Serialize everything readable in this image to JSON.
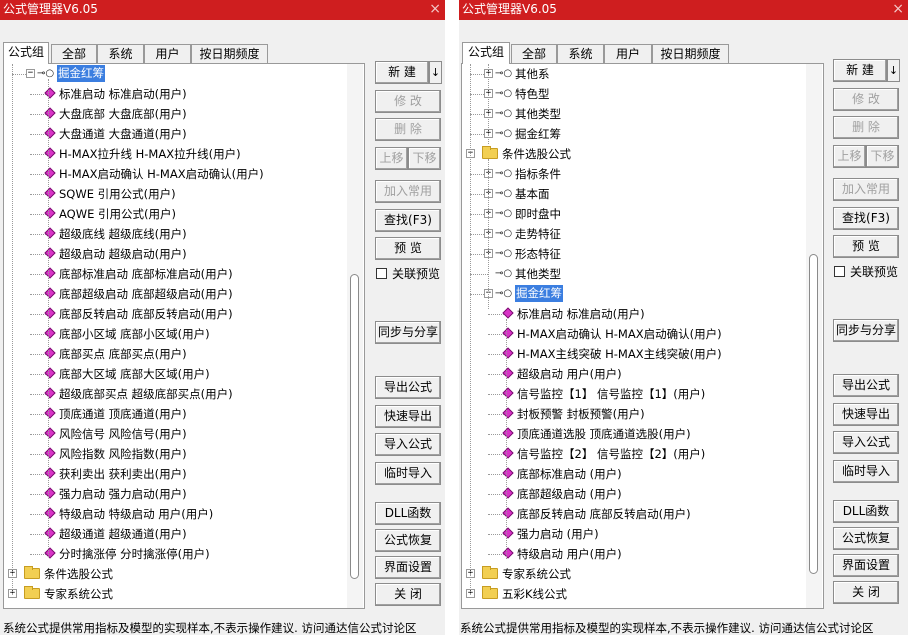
{
  "windows": [
    {
      "title": "公式管理器V6.05",
      "close_glyph": "×",
      "tabs": [
        "公式组",
        "全部",
        "系统",
        "用户",
        "按日期频度"
      ],
      "active_tab": 0,
      "tree": [
        {
          "depth": 1,
          "kind": "group",
          "expander": "minus",
          "text": "掘金红筹",
          "selected": true
        },
        {
          "depth": 2,
          "kind": "formula",
          "text": "标准启动   标准启动(用户)"
        },
        {
          "depth": 2,
          "kind": "formula",
          "text": "大盘底部   大盘底部(用户)"
        },
        {
          "depth": 2,
          "kind": "formula",
          "text": "大盘通道   大盘通道(用户)"
        },
        {
          "depth": 2,
          "kind": "formula",
          "text": "H-MAX拉升线   H-MAX拉升线(用户)"
        },
        {
          "depth": 2,
          "kind": "formula",
          "text": "H-MAX启动确认   H-MAX启动确认(用户)"
        },
        {
          "depth": 2,
          "kind": "formula",
          "text": "SQWE   引用公式(用户)"
        },
        {
          "depth": 2,
          "kind": "formula",
          "text": "AQWE   引用公式(用户)"
        },
        {
          "depth": 2,
          "kind": "formula",
          "text": "超级底线   超级底线(用户)"
        },
        {
          "depth": 2,
          "kind": "formula",
          "text": "超级启动   超级启动(用户)"
        },
        {
          "depth": 2,
          "kind": "formula",
          "text": "底部标准启动   底部标准启动(用户)"
        },
        {
          "depth": 2,
          "kind": "formula",
          "text": "底部超级启动   底部超级启动(用户)"
        },
        {
          "depth": 2,
          "kind": "formula",
          "text": "底部反转启动   底部反转启动(用户)"
        },
        {
          "depth": 2,
          "kind": "formula",
          "text": "底部小区域   底部小区域(用户)"
        },
        {
          "depth": 2,
          "kind": "formula",
          "text": "底部买点   底部买点(用户)"
        },
        {
          "depth": 2,
          "kind": "formula",
          "text": "底部大区域   底部大区域(用户)"
        },
        {
          "depth": 2,
          "kind": "formula",
          "text": "超级底部买点   超级底部买点(用户)"
        },
        {
          "depth": 2,
          "kind": "formula",
          "text": "顶底通道   顶底通道(用户)"
        },
        {
          "depth": 2,
          "kind": "formula",
          "text": "风险信号   风险信号(用户)"
        },
        {
          "depth": 2,
          "kind": "formula",
          "text": "风险指数   风险指数(用户)"
        },
        {
          "depth": 2,
          "kind": "formula",
          "text": "获利卖出   获利卖出(用户)"
        },
        {
          "depth": 2,
          "kind": "formula",
          "text": "强力启动   强力启动(用户)"
        },
        {
          "depth": 2,
          "kind": "formula",
          "text": "特级启动   特级启动 用户(用户)"
        },
        {
          "depth": 2,
          "kind": "formula",
          "text": "超级通道   超级通道(用户)"
        },
        {
          "depth": 2,
          "kind": "formula",
          "text": "分时擒涨停   分时擒涨停(用户)"
        },
        {
          "depth": 0,
          "kind": "folder",
          "expander": "plus",
          "text": "条件选股公式"
        },
        {
          "depth": 0,
          "kind": "folder",
          "expander": "plus",
          "text": "专家系统公式"
        }
      ],
      "buttons": {
        "new": "新 建",
        "new_arrow": "↓",
        "modify": "修 改",
        "delete": "删 除",
        "move_up": "上移",
        "move_down": "下移",
        "add_common": "加入常用",
        "find": "查找(F3)",
        "preview": "预 览",
        "linked_preview": "关联预览",
        "sync_share": "同步与分享",
        "export": "导出公式",
        "quick_export": "快速导出",
        "import": "导入公式",
        "temp_import": "临时导入",
        "dll": "DLL函数",
        "restore": "公式恢复",
        "ui_settings": "界面设置",
        "close": "关 闭"
      },
      "status": "系统公式提供常用指标及模型的实现样本,不表示操作建议.    访问通达信公式讨论区"
    },
    {
      "title": "公式管理器V6.05",
      "close_glyph": "×",
      "tabs": [
        "公式组",
        "全部",
        "系统",
        "用户",
        "按日期频度"
      ],
      "active_tab": 0,
      "tree": [
        {
          "depth": 1,
          "kind": "group",
          "expander": "plus",
          "text": "其他系"
        },
        {
          "depth": 1,
          "kind": "group",
          "expander": "plus",
          "text": "特色型"
        },
        {
          "depth": 1,
          "kind": "group",
          "expander": "plus",
          "text": "其他类型"
        },
        {
          "depth": 1,
          "kind": "group",
          "expander": "plus",
          "text": "掘金红筹"
        },
        {
          "depth": 0,
          "kind": "folder",
          "expander": "minus",
          "text": "条件选股公式"
        },
        {
          "depth": 1,
          "kind": "group",
          "expander": "plus",
          "text": "指标条件"
        },
        {
          "depth": 1,
          "kind": "group",
          "expander": "plus",
          "text": "基本面"
        },
        {
          "depth": 1,
          "kind": "group",
          "expander": "plus",
          "text": "即时盘中"
        },
        {
          "depth": 1,
          "kind": "group",
          "expander": "plus",
          "text": "走势特征"
        },
        {
          "depth": 1,
          "kind": "group",
          "expander": "plus",
          "text": "形态特征"
        },
        {
          "depth": 1,
          "kind": "group",
          "expander": "none",
          "text": "其他类型"
        },
        {
          "depth": 1,
          "kind": "group",
          "expander": "minus",
          "text": "掘金红筹",
          "selected": true
        },
        {
          "depth": 2,
          "kind": "formula",
          "text": "标准启动   标准启动(用户)"
        },
        {
          "depth": 2,
          "kind": "formula",
          "text": "H-MAX启动确认   H-MAX启动确认(用户)"
        },
        {
          "depth": 2,
          "kind": "formula",
          "text": "H-MAX主线突破   H-MAX主线突破(用户)"
        },
        {
          "depth": 2,
          "kind": "formula",
          "text": "超级启动   用户(用户)"
        },
        {
          "depth": 2,
          "kind": "formula",
          "text": "信号监控【1】   信号监控【1】(用户)"
        },
        {
          "depth": 2,
          "kind": "formula",
          "text": "封板预警   封板预警(用户)"
        },
        {
          "depth": 2,
          "kind": "formula",
          "text": "顶底通道选股   顶底通道选股(用户)"
        },
        {
          "depth": 2,
          "kind": "formula",
          "text": "信号监控【2】   信号监控【2】(用户)"
        },
        {
          "depth": 2,
          "kind": "formula",
          "text": "底部标准启动   (用户)"
        },
        {
          "depth": 2,
          "kind": "formula",
          "text": "底部超级启动   (用户)"
        },
        {
          "depth": 2,
          "kind": "formula",
          "text": "底部反转启动   底部反转启动(用户)"
        },
        {
          "depth": 2,
          "kind": "formula",
          "text": "强力启动   (用户)"
        },
        {
          "depth": 2,
          "kind": "formula",
          "text": "特级启动   用户(用户)"
        },
        {
          "depth": 0,
          "kind": "folder",
          "expander": "plus",
          "text": "专家系统公式"
        },
        {
          "depth": 0,
          "kind": "folder",
          "expander": "plus",
          "text": "五彩K线公式"
        }
      ],
      "buttons": {
        "new": "新 建",
        "new_arrow": "↓",
        "modify": "修 改",
        "delete": "删 除",
        "move_up": "上移",
        "move_down": "下移",
        "add_common": "加入常用",
        "find": "查找(F3)",
        "preview": "预 览",
        "linked_preview": "关联预览",
        "sync_share": "同步与分享",
        "export": "导出公式",
        "quick_export": "快速导出",
        "import": "导入公式",
        "temp_import": "临时导入",
        "dll": "DLL函数",
        "restore": "公式恢复",
        "ui_settings": "界面设置",
        "close": "关 闭"
      },
      "status": "系统公式提供常用指标及模型的实现样本,不表示操作建议.    访问通达信公式讨论区"
    }
  ],
  "colors": {
    "title_bar": "#cf1e1f",
    "selection": "#3b7ee0",
    "formula_icon": "#d833c6",
    "folder_icon": "#f2cf52"
  },
  "icons": {
    "group": "key-icon",
    "folder": "folder-icon",
    "formula": "formula-diamond-icon"
  }
}
